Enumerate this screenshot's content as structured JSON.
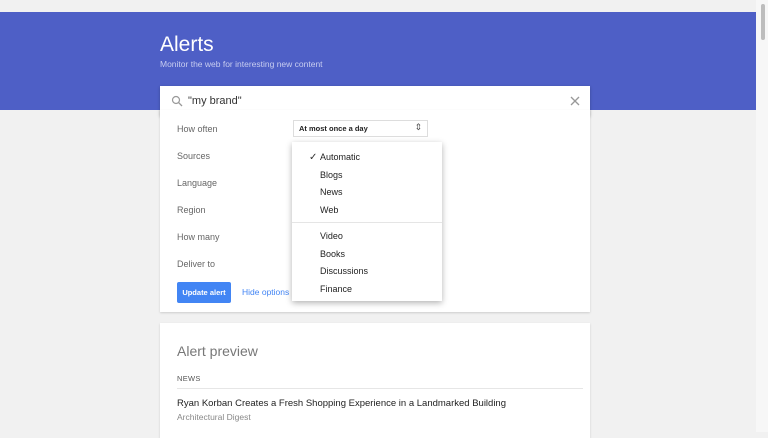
{
  "header": {
    "title": "Alerts",
    "subtitle": "Monitor the web for interesting new content",
    "color": "#4e5fc6"
  },
  "search": {
    "value": "\"my brand\"",
    "icon": "search-icon",
    "clear_icon": "close-icon"
  },
  "options": {
    "how_often_label": "How often",
    "how_often_value": "At most once a day",
    "sources_label": "Sources",
    "language_label": "Language",
    "region_label": "Region",
    "how_many_label": "How many",
    "deliver_to_label": "Deliver to",
    "update_button": "Update alert",
    "hide_options": "Hide options"
  },
  "sources_dropdown": {
    "selected": "Automatic",
    "group1": [
      "Automatic",
      "Blogs",
      "News",
      "Web"
    ],
    "group2": [
      "Video",
      "Books",
      "Discussions",
      "Finance"
    ]
  },
  "preview": {
    "title": "Alert preview",
    "section_label": "NEWS",
    "article_title": "Ryan Korban Creates a Fresh Shopping Experience in a Landmarked Building",
    "article_source": "Architectural Digest"
  },
  "colors": {
    "accent": "#4285f4",
    "background": "#f1f1f1"
  }
}
